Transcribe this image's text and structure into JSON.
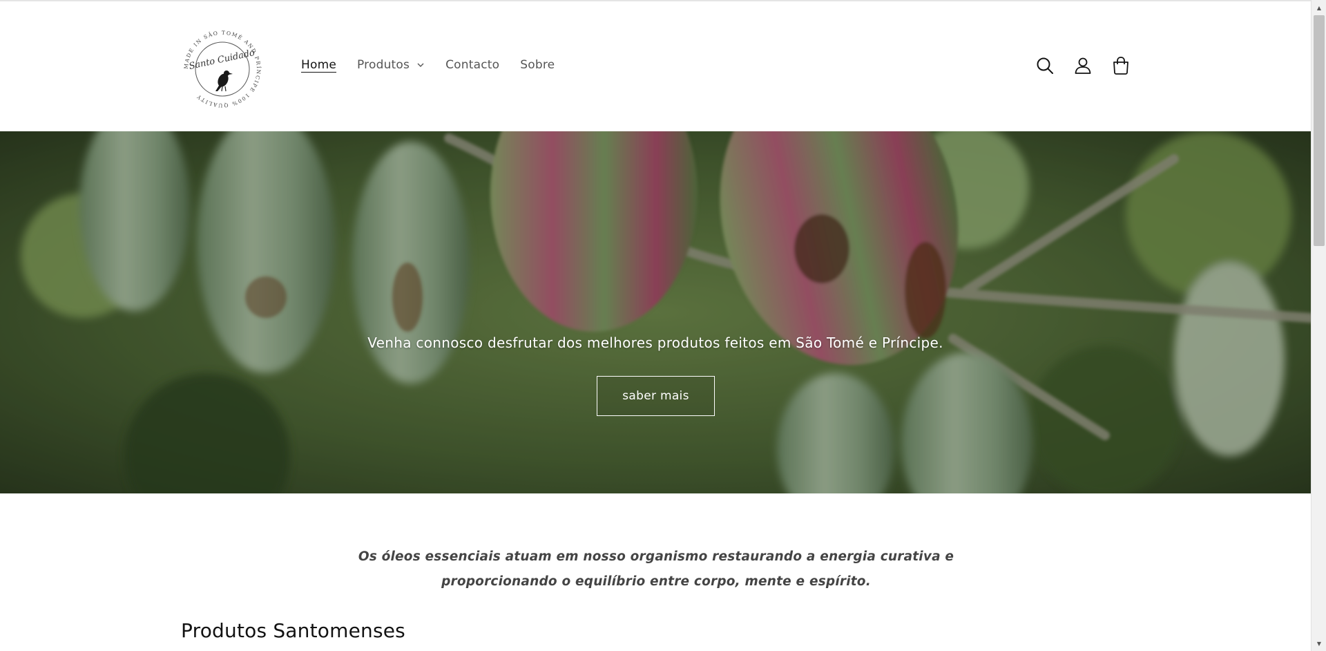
{
  "header": {
    "logo_text": "Santo Cuidado",
    "logo_ring_text": "MADE IN SÃO TOMÉ AND PRÍNCIPE 100% QUALITY",
    "nav": [
      {
        "label": "Home",
        "active": true
      },
      {
        "label": "Produtos",
        "has_dropdown": true
      },
      {
        "label": "Contacto"
      },
      {
        "label": "Sobre"
      }
    ],
    "icons": [
      "search-icon",
      "account-icon",
      "cart-icon"
    ]
  },
  "hero": {
    "text": "Venha connosco desfrutar dos melhores produtos feitos em São Tomé e Príncipe.",
    "button_label": "saber mais"
  },
  "quote": {
    "text": "Os óleos essenciais atuam em nosso organismo restaurando a energia curativa e proporcionando o equilíbrio entre corpo, mente e espírito."
  },
  "section": {
    "title": "Produtos Santomenses"
  },
  "colors": {
    "text": "#121212",
    "muted": "#555555",
    "hero_green": "#55693f",
    "pod_red": "#9e4059",
    "pod_green": "#7c9a6e"
  }
}
